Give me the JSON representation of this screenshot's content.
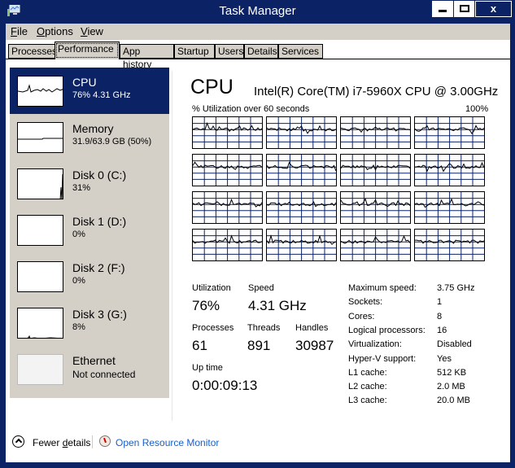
{
  "window": {
    "title": "Task Manager",
    "controls": {
      "minimize": "minimize",
      "maximize": "maximize",
      "close": "x"
    }
  },
  "menu": [
    {
      "label": "File",
      "accel": "F",
      "rest": "ile"
    },
    {
      "label": "Options",
      "accel": "O",
      "rest": "ptions"
    },
    {
      "label": "View",
      "accel": "V",
      "rest": "iew"
    }
  ],
  "tabs": [
    {
      "label": "Processes",
      "active": false
    },
    {
      "label": "Performance",
      "active": true
    },
    {
      "label": "App history",
      "active": false
    },
    {
      "label": "Startup",
      "active": false
    },
    {
      "label": "Users",
      "active": false
    },
    {
      "label": "Details",
      "active": false
    },
    {
      "label": "Services",
      "active": false
    }
  ],
  "sidebar": {
    "items": [
      {
        "name": "CPU",
        "value": "76% 4.31 GHz",
        "selected": true
      },
      {
        "name": "Memory",
        "value": "31.9/63.9 GB (50%)",
        "selected": false
      },
      {
        "name": "Disk 0 (C:)",
        "value": "31%",
        "selected": false
      },
      {
        "name": "Disk 1 (D:)",
        "value": "0%",
        "selected": false
      },
      {
        "name": "Disk 2 (F:)",
        "value": "0%",
        "selected": false
      },
      {
        "name": "Disk 3 (G:)",
        "value": "8%",
        "selected": false
      },
      {
        "name": "Ethernet",
        "value": "Not connected",
        "selected": false
      }
    ]
  },
  "main": {
    "title": "CPU",
    "model": "Intel(R) Core(TM) i7-5960X CPU @ 3.00GHz",
    "graph_label": "% Utilization over 60 seconds",
    "graph_max": "100%",
    "core_count": 16,
    "stats": {
      "utilization_label": "Utilization",
      "utilization": "76%",
      "speed_label": "Speed",
      "speed": "4.31 GHz",
      "processes_label": "Processes",
      "processes": "61",
      "threads_label": "Threads",
      "threads": "891",
      "handles_label": "Handles",
      "handles": "30987",
      "uptime_label": "Up time",
      "uptime": "0:00:09:13"
    },
    "specs": [
      {
        "label": "Maximum speed:",
        "value": "3.75 GHz"
      },
      {
        "label": "Sockets:",
        "value": "1"
      },
      {
        "label": "Cores:",
        "value": "8"
      },
      {
        "label": "Logical processors:",
        "value": "16"
      },
      {
        "label": "Virtualization:",
        "value": "Disabled"
      },
      {
        "label": "Hyper-V support:",
        "value": "Yes"
      },
      {
        "label": "L1 cache:",
        "value": "512 KB"
      },
      {
        "label": "L2 cache:",
        "value": "2.0 MB"
      },
      {
        "label": "L3 cache:",
        "value": "20.0 MB"
      }
    ]
  },
  "footer": {
    "fewer_details": "Fewer details",
    "fewer_accel": "d",
    "open_resource_monitor": "Open Resource Monitor"
  },
  "colors": {
    "frame": "#0b2265",
    "panel": "#d4d0c8",
    "grid": "#0b2265",
    "link": "#1a5fc8"
  }
}
